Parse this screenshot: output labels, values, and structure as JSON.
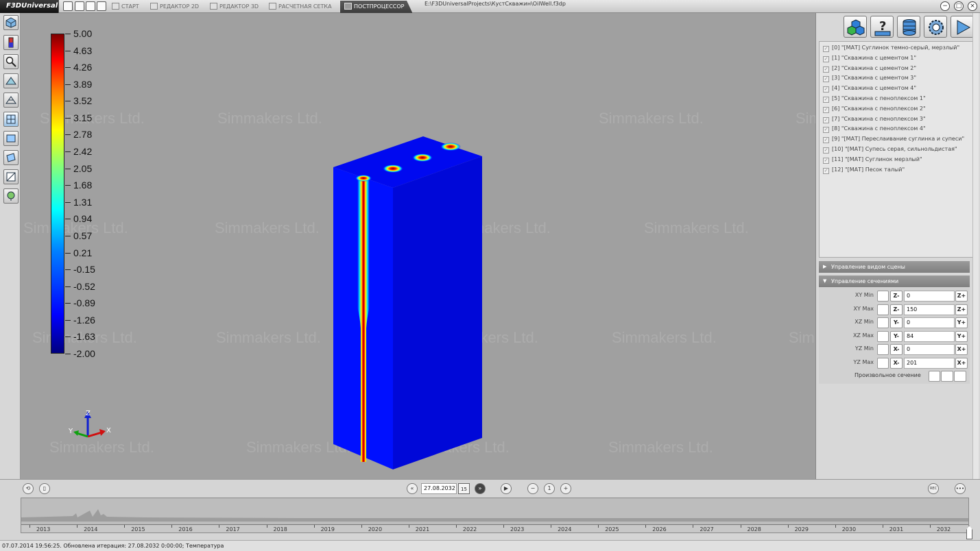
{
  "app": {
    "logo": "F3DUniversal",
    "file_path": "E:\\F3DUniversalProjects\\КустСкважин\\OilWell.f3dp",
    "tabs": [
      {
        "label": "СТАРТ",
        "active": false
      },
      {
        "label": "РЕДАКТОР 2D",
        "active": false
      },
      {
        "label": "РЕДАКТОР 3D",
        "active": false
      },
      {
        "label": "РАСЧЕТНАЯ СЕТКА",
        "active": false
      },
      {
        "label": "ПОСТПРОЦЕССОР",
        "active": true
      }
    ]
  },
  "viewport": {
    "watermark": "Simmakers Ltd.",
    "legend": [
      "5.00",
      "4.63",
      "4.26",
      "3.89",
      "3.52",
      "3.15",
      "2.78",
      "2.42",
      "2.05",
      "1.68",
      "1.31",
      "0.94",
      "0.57",
      "0.21",
      "-0.15",
      "-0.52",
      "-0.89",
      "-1.26",
      "-1.63",
      "-2.00"
    ],
    "axes": {
      "z": "Z",
      "y": "Y",
      "x": "X"
    }
  },
  "layers": [
    "[0] \"[МАТ] Суглинок темно-серый, мерзлый\"",
    "[1] \"Скважина с цементом 1\"",
    "[2] \"Скважина с цементом 2\"",
    "[3] \"Скважина с цементом 3\"",
    "[4] \"Скважина с цементом 4\"",
    "[5] \"Скважина с пеноплексом 1\"",
    "[6] \"Скважина с пеноплексом 2\"",
    "[7] \"Скважина с пеноплексом 3\"",
    "[8] \"Скважина с пеноплексом 4\"",
    "[9] \"[МАТ] Переслаивание суглинка и супеси\"",
    "[10] \"[МАТ] Супесь серая, сильнольдистая\"",
    "[11] \"[МАТ] Суглинок мерзлый\"",
    "[12] \"[МАТ] Песок талый\""
  ],
  "panels": {
    "scene_view": "Управление видом сцены",
    "sections": "Управление сечениями"
  },
  "sections": [
    {
      "label": "XY Min",
      "minus": "Z-",
      "value": "0",
      "plus": "Z+"
    },
    {
      "label": "XY Max",
      "minus": "Z-",
      "value": "150",
      "plus": "Z+"
    },
    {
      "label": "XZ Min",
      "minus": "Y-",
      "value": "0",
      "plus": "Y+"
    },
    {
      "label": "XZ Max",
      "minus": "Y-",
      "value": "84",
      "plus": "Y+"
    },
    {
      "label": "YZ Min",
      "minus": "X-",
      "value": "0",
      "plus": "X+"
    },
    {
      "label": "YZ Max",
      "minus": "X-",
      "value": "201",
      "plus": "X+"
    }
  ],
  "arbitrary_section": "Произвольное сечение",
  "playback": {
    "date": "27.08.2032",
    "calendar": "15",
    "step": "1",
    "rec": "REC",
    "more": "•••"
  },
  "timeline": {
    "years": [
      "2013",
      "2014",
      "2015",
      "2016",
      "2017",
      "2018",
      "2019",
      "2020",
      "2021",
      "2022",
      "2023",
      "2024",
      "2025",
      "2026",
      "2027",
      "2028",
      "2029",
      "2030",
      "2031",
      "2032"
    ]
  },
  "status": "07.07.2014 19:56:25. Обновлена итерация: 27.08.2032 0:00:00; Температура"
}
